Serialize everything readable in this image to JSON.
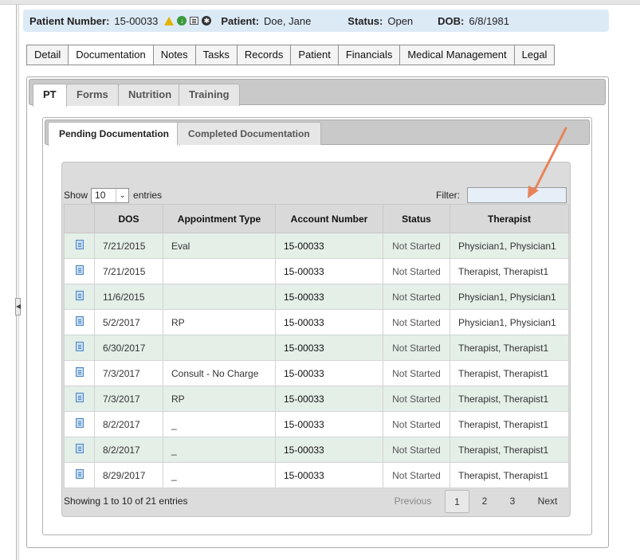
{
  "patient": {
    "number_label": "Patient Number:",
    "number": "15-00033",
    "name_label": "Patient:",
    "name": "Doe, Jane",
    "status_label": "Status:",
    "status": "Open",
    "dob_label": "DOB:",
    "dob": "6/8/1981",
    "icons": [
      "warning-icon",
      "download-icon",
      "card-icon",
      "settings-icon"
    ]
  },
  "main_tabs": [
    "Detail",
    "Documentation",
    "Notes",
    "Tasks",
    "Records",
    "Patient",
    "Financials",
    "Medical Management",
    "Legal"
  ],
  "main_tab_active": "Documentation",
  "sub_tabs": [
    "PT",
    "Forms",
    "Nutrition",
    "Training"
  ],
  "sub_tab_active": "PT",
  "doc_tabs": [
    "Pending Documentation",
    "Completed Documentation"
  ],
  "doc_tab_active": "Pending Documentation",
  "table_controls": {
    "show_label": "Show",
    "page_length": "10",
    "entries_label": "entries",
    "filter_label": "Filter:",
    "filter_value": ""
  },
  "table": {
    "columns": [
      "",
      "DOS",
      "Appointment Type",
      "Account Number",
      "Status",
      "Therapist"
    ],
    "rows": [
      {
        "dos": "7/21/2015",
        "type": "Eval",
        "account": "15-00033",
        "status": "Not Started",
        "therapist": "Physician1, Physician1"
      },
      {
        "dos": "7/21/2015",
        "type": "",
        "account": "15-00033",
        "status": "Not Started",
        "therapist": "Therapist, Therapist1"
      },
      {
        "dos": "11/6/2015",
        "type": "",
        "account": "15-00033",
        "status": "Not Started",
        "therapist": "Physician1, Physician1"
      },
      {
        "dos": "5/2/2017",
        "type": "RP",
        "account": "15-00033",
        "status": "Not Started",
        "therapist": "Physician1, Physician1"
      },
      {
        "dos": "6/30/2017",
        "type": "",
        "account": "15-00033",
        "status": "Not Started",
        "therapist": "Therapist, Therapist1"
      },
      {
        "dos": "7/3/2017",
        "type": "Consult - No Charge",
        "account": "15-00033",
        "status": "Not Started",
        "therapist": "Therapist, Therapist1"
      },
      {
        "dos": "7/3/2017",
        "type": "RP",
        "account": "15-00033",
        "status": "Not Started",
        "therapist": "Therapist, Therapist1"
      },
      {
        "dos": "8/2/2017",
        "type": "_",
        "account": "15-00033",
        "status": "Not Started",
        "therapist": "Therapist, Therapist1"
      },
      {
        "dos": "8/2/2017",
        "type": "_",
        "account": "15-00033",
        "status": "Not Started",
        "therapist": "Therapist, Therapist1"
      },
      {
        "dos": "8/29/2017",
        "type": "_",
        "account": "15-00033",
        "status": "Not Started",
        "therapist": "Therapist, Therapist1"
      }
    ]
  },
  "footer": {
    "info": "Showing 1 to 10 of 21 entries",
    "previous": "Previous",
    "pages": [
      "1",
      "2",
      "3"
    ],
    "current_page": "1",
    "next": "Next"
  },
  "colors": {
    "patient_bar": "#dceaf6",
    "row_odd": "#e4efe8",
    "annotation_arrow": "#e8825a",
    "filter_input": "#e6eff8"
  }
}
